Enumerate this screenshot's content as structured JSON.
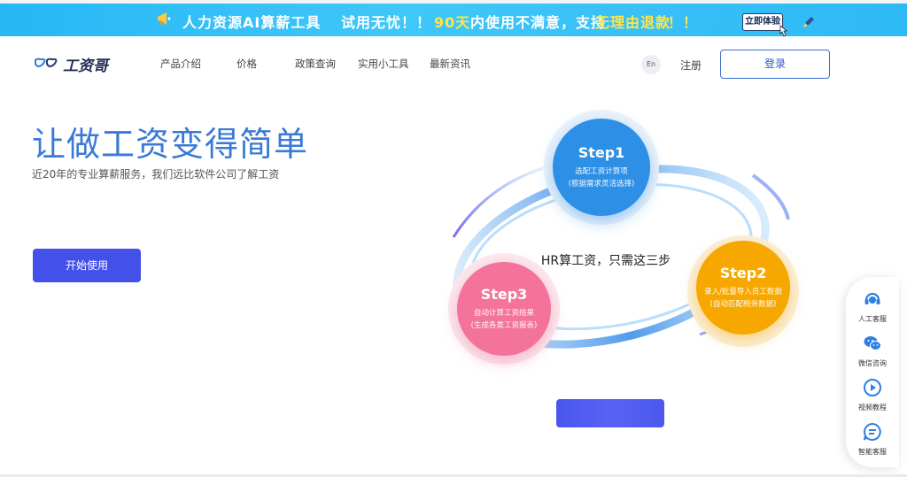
{
  "banner": {
    "part1": "人力资源AI算薪工具",
    "part2": "试用无忧！！",
    "part3a": "90天",
    "part3b": "内使用不满意，支持",
    "part3c": "无理由退款",
    "part3d": "！！",
    "cta": "立即体验"
  },
  "nav": {
    "logo": "工资哥",
    "items": [
      "产品介绍",
      "价格",
      "政策查询",
      "实用小工具",
      "最新资讯"
    ],
    "lang": "En",
    "register": "注册",
    "login": "登录"
  },
  "hero": {
    "title": "让做工资变得简单",
    "subtitle": "近20年的专业算薪服务，我们远比软件公司了解工资",
    "start": "开始使用"
  },
  "diagram": {
    "center": "HR算工资，只需这三步",
    "steps": [
      {
        "title": "Step1",
        "line1": "选配工资计算项",
        "line2": "(根据需求灵活选择)",
        "color": "#2d8fe6"
      },
      {
        "title": "Step2",
        "line1": "录入/批量导入员工数据",
        "line2": "(自动匹配税务数据)",
        "color": "#f7a800"
      },
      {
        "title": "Step3",
        "line1": "自动计算工资结果",
        "line2": "(生成各类工资报表)",
        "color": "#f4739a"
      }
    ]
  },
  "sidebar": {
    "items": [
      {
        "label": "人工客服",
        "icon": "headset-icon"
      },
      {
        "label": "微信咨询",
        "icon": "wechat-icon"
      },
      {
        "label": "视频教程",
        "icon": "play-icon"
      },
      {
        "label": "智能客服",
        "icon": "chat-bubble-icon"
      }
    ]
  },
  "colors": {
    "accent": "#3a7ad6",
    "button": "#4350ea",
    "banner": "#2eb9f5"
  }
}
